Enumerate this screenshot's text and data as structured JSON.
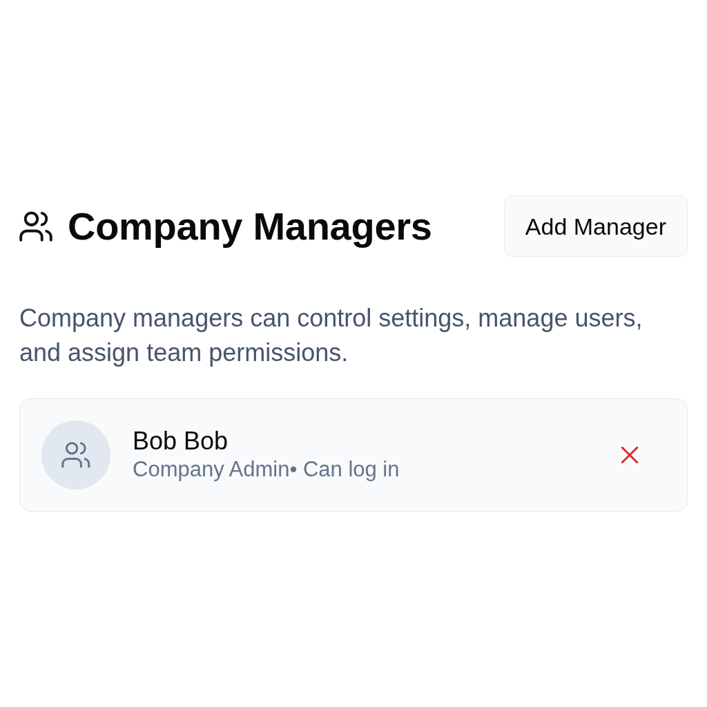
{
  "header": {
    "title": "Company Managers",
    "button": "Add Manager"
  },
  "description": "Company managers can control settings, manage users, and assign team permissions.",
  "managers": [
    {
      "name": "Bob Bob",
      "subtitle": "Company Admin• Can log in"
    }
  ]
}
